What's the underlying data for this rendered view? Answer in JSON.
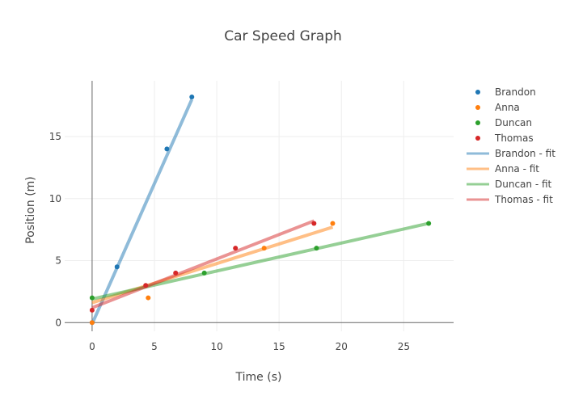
{
  "chart_data": {
    "type": "scatter",
    "title": "Car Speed Graph",
    "xlabel": "Time (s)",
    "ylabel": "Position (m)",
    "xlim": [
      -2.2,
      29
    ],
    "ylim": [
      -0.7,
      19.5
    ],
    "xticks": [
      0,
      5,
      10,
      15,
      20,
      25
    ],
    "yticks": [
      0,
      5,
      10,
      15
    ],
    "grid": true,
    "legend_position": "right",
    "series": [
      {
        "name": "Brandon",
        "mode": "markers",
        "color": "#1f77b4",
        "x": [
          0,
          2,
          6,
          8
        ],
        "y": [
          0,
          4.5,
          14,
          18.2
        ]
      },
      {
        "name": "Anna",
        "mode": "markers",
        "color": "#ff7f0e",
        "x": [
          0,
          4.5,
          13.8,
          19.3
        ],
        "y": [
          0,
          2,
          6,
          8
        ]
      },
      {
        "name": "Duncan",
        "mode": "markers",
        "color": "#2ca02c",
        "x": [
          0,
          9,
          18,
          27
        ],
        "y": [
          2,
          4,
          6,
          8
        ]
      },
      {
        "name": "Thomas",
        "mode": "markers",
        "color": "#d62728",
        "x": [
          0,
          4.3,
          6.7,
          11.5,
          17.8
        ],
        "y": [
          1,
          3,
          4,
          6,
          8
        ]
      },
      {
        "name": "Brandon - fit",
        "mode": "lines",
        "color": "#1f77b4",
        "x": [
          0,
          8
        ],
        "y": [
          -0.1,
          18.0
        ]
      },
      {
        "name": "Anna - fit",
        "mode": "lines",
        "color": "#ff7f0e",
        "x": [
          0,
          19.3
        ],
        "y": [
          1.6,
          7.7
        ]
      },
      {
        "name": "Duncan - fit",
        "mode": "lines",
        "color": "#2ca02c",
        "x": [
          0,
          27
        ],
        "y": [
          1.9,
          8.0
        ]
      },
      {
        "name": "Thomas - fit",
        "mode": "lines",
        "color": "#d62728",
        "x": [
          0,
          17.8
        ],
        "y": [
          1.2,
          8.2
        ]
      }
    ]
  }
}
